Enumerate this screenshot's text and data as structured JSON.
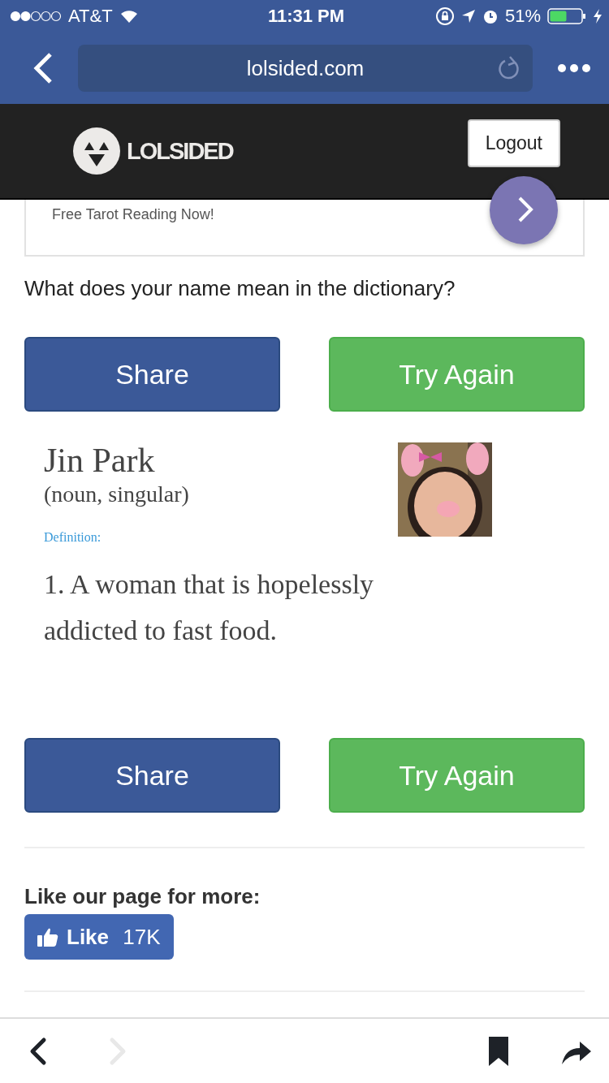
{
  "status_bar": {
    "carrier": "AT&T",
    "time": "11:31 PM",
    "battery": "51%"
  },
  "browser": {
    "url": "lolsided.com",
    "toolbar": [
      {
        "kind": "back",
        "disabled": false
      },
      {
        "kind": "forward",
        "disabled": true
      },
      {
        "kind": "bookmark",
        "disabled": false
      },
      {
        "kind": "share",
        "disabled": false
      }
    ]
  },
  "header": {
    "logo": "LOLSIDED",
    "logout": "Logout"
  },
  "ad": {
    "text": "Free Tarot Reading Now!"
  },
  "question": "What does your name mean in the dictionary?",
  "actions_top": [
    {
      "label": "Share",
      "kind": "share"
    },
    {
      "label": "Try Again",
      "kind": "retry"
    }
  ],
  "result": {
    "name": "Jin Park",
    "grammar": "(noun, singular)",
    "definition_label": "Definition:",
    "definition": "1. A woman that is hopelessly addicted to fast food."
  },
  "actions_bottom": [
    {
      "label": "Share",
      "kind": "share"
    },
    {
      "label": "Try Again",
      "kind": "retry"
    }
  ],
  "like": {
    "prompt": "Like our page for more:",
    "button": "Like",
    "count": "17K"
  }
}
